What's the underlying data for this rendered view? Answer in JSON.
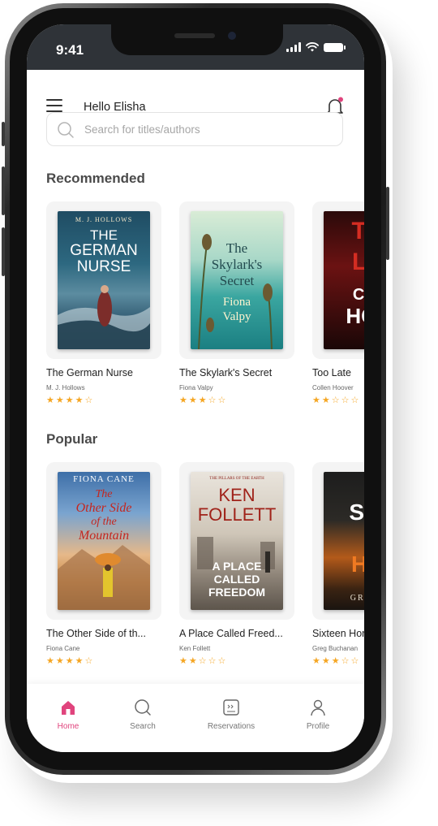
{
  "status_bar": {
    "time": "9:41"
  },
  "header": {
    "greeting": "Hello Elisha"
  },
  "search": {
    "placeholder": "Search for titles/authors"
  },
  "sections": {
    "recommended": {
      "title": "Recommended",
      "books": [
        {
          "title": "The German Nurse",
          "author": "M. J. Hollows",
          "rating": 4,
          "rating_max": 5,
          "stars": "★★★★☆",
          "cover": {
            "top": "M. J. HOLLOWS",
            "line1": "THE",
            "line2": "GERMAN",
            "line3": "NURSE"
          }
        },
        {
          "title": "The Skylark's Secret",
          "author": "Fiona Valpy",
          "rating": 3,
          "rating_max": 5,
          "stars": "★★★☆☆",
          "cover": {
            "line1": "The",
            "line2": "Skylark's",
            "line3": "Secret",
            "line4": "Fiona",
            "line5": "Valpy"
          }
        },
        {
          "title": "Too Late",
          "author": "Collen Hoover",
          "rating": 2,
          "rating_max": 5,
          "stars": "★★☆☆☆",
          "cover": {
            "line1": "TO",
            "line2": "LA",
            "line3": "COL",
            "line4": "HOO"
          }
        }
      ]
    },
    "popular": {
      "title": "Popular",
      "books": [
        {
          "title": "The Other Side of th...",
          "author": "Fiona Cane",
          "rating": 4,
          "rating_max": 5,
          "stars": "★★★★☆",
          "cover": {
            "top": "FIONA CANE",
            "line1": "The",
            "line2": "Other Side",
            "line3": "of the",
            "line4": "Mountain"
          }
        },
        {
          "title": "A Place Called Freed...",
          "author": "Ken Follett",
          "rating": 2,
          "rating_max": 5,
          "stars": "★★☆☆☆",
          "cover": {
            "top": "THE PILLARS OF THE EARTH",
            "line1": "KEN",
            "line2": "FOLLETT",
            "line3": "A PLACE",
            "line4": "CALLED",
            "line5": "FREEDOM"
          }
        },
        {
          "title": "Sixteen Hor",
          "author": "Greg Buchanan",
          "rating": 3,
          "rating_max": 5,
          "stars": "★★★☆☆",
          "cover": {
            "line1": "SIX",
            "line2": "HO",
            "line3": "GREG B"
          }
        }
      ]
    }
  },
  "nav": {
    "items": [
      {
        "label": "Home",
        "icon": "home-icon",
        "active": true
      },
      {
        "label": "Search",
        "icon": "search-icon",
        "active": false
      },
      {
        "label": "Reservations",
        "icon": "reservations-icon",
        "active": false
      },
      {
        "label": "Profile",
        "icon": "profile-icon",
        "active": false
      }
    ]
  },
  "colors": {
    "accent": "#e0447d",
    "star": "#f5a623",
    "status_bar": "#2f3338"
  }
}
